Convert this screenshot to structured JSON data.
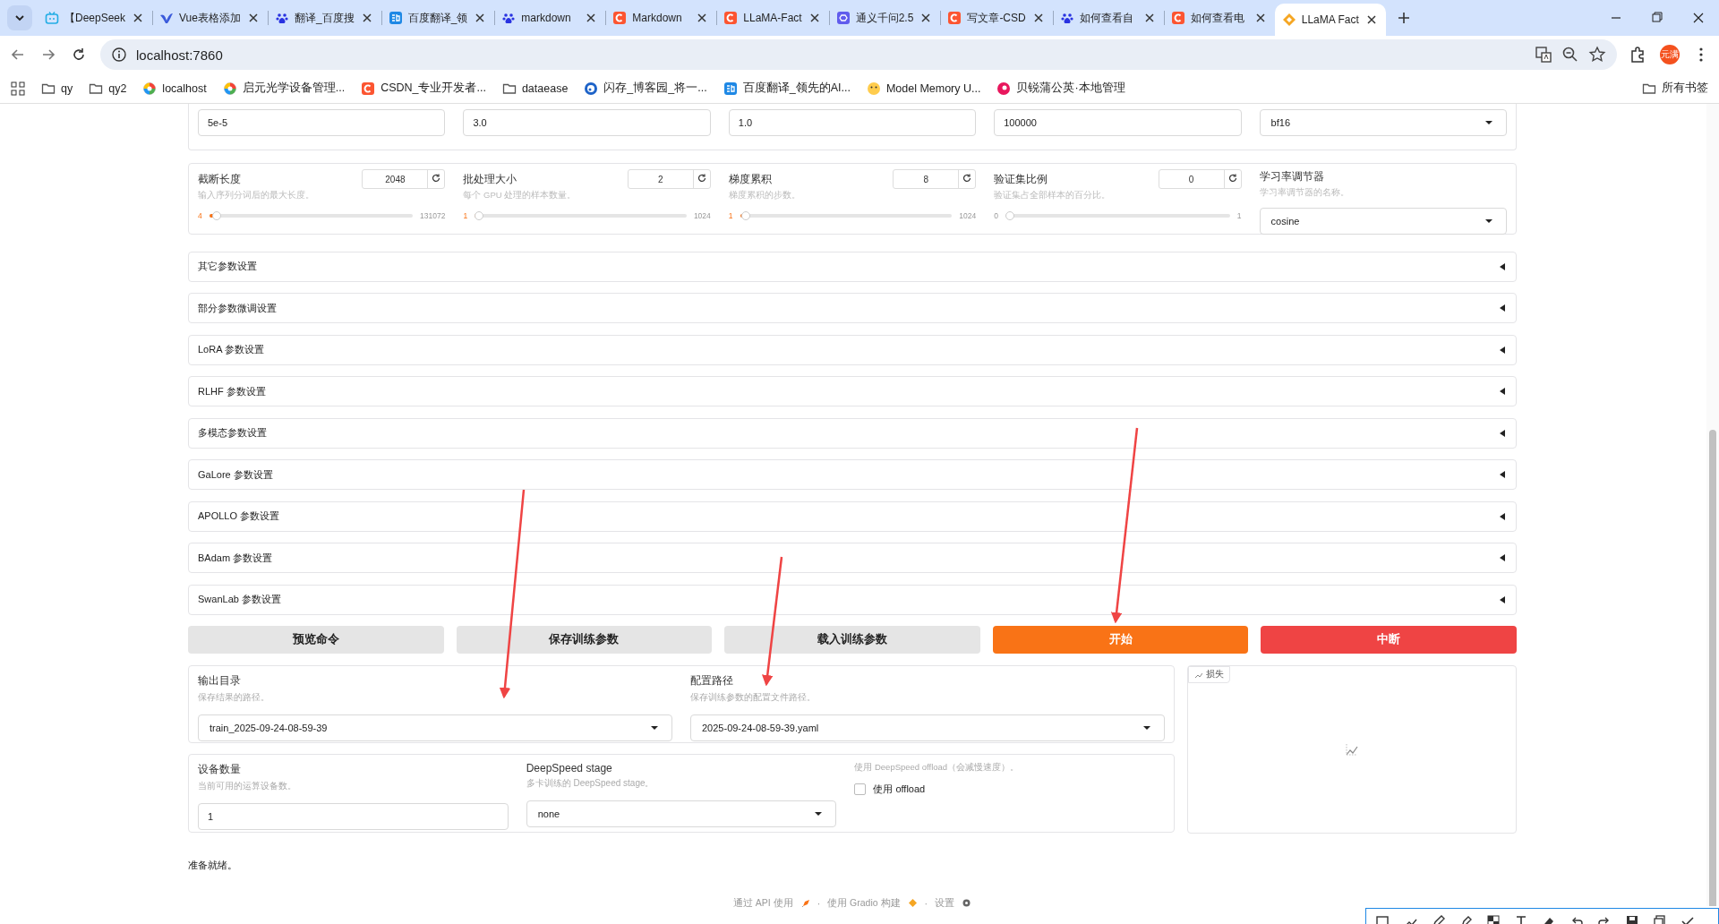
{
  "browser": {
    "tabs": [
      {
        "title": "【DeepSeek",
        "kind": "bilibili",
        "selected": false
      },
      {
        "title": "Vue表格添加",
        "kind": "vue",
        "selected": false
      },
      {
        "title": "翻译_百度搜",
        "kind": "baidu",
        "selected": false
      },
      {
        "title": "百度翻译_领",
        "kind": "fanyi",
        "selected": false
      },
      {
        "title": "markdown",
        "kind": "baidu",
        "selected": false
      },
      {
        "title": "Markdown",
        "kind": "csdn",
        "selected": false
      },
      {
        "title": "LLaMA-Fact",
        "kind": "csdn",
        "selected": false
      },
      {
        "title": "通义千问2.5",
        "kind": "tongyi",
        "selected": false
      },
      {
        "title": "写文章-CSD",
        "kind": "csdn",
        "selected": false
      },
      {
        "title": "如何查看自",
        "kind": "baidu",
        "selected": false
      },
      {
        "title": "如何查看电",
        "kind": "csdn",
        "selected": false
      },
      {
        "title": "LLaMA Fact",
        "kind": "llama",
        "selected": true
      }
    ],
    "url": "localhost:7860",
    "profile": "元满",
    "bookmarks": [
      {
        "label": "qy",
        "kind": "folder"
      },
      {
        "label": "qy2",
        "kind": "folder"
      },
      {
        "label": "localhost",
        "kind": "globe"
      },
      {
        "label": "启元光学设备管理...",
        "kind": "globe"
      },
      {
        "label": "CSDN_专业开发者...",
        "kind": "csdn"
      },
      {
        "label": "dataease",
        "kind": "folder"
      },
      {
        "label": "闪存_博客园_将一...",
        "kind": "cnblogs"
      },
      {
        "label": "百度翻译_领先的AI...",
        "kind": "fanyi"
      },
      {
        "label": "Model Memory U...",
        "kind": "hf"
      },
      {
        "label": "贝锐蒲公英·本地管理",
        "kind": "pgy"
      }
    ],
    "all_bookmarks": "所有书签"
  },
  "page": {
    "top_fields": [
      "5e-5",
      "3.0",
      "1.0",
      "100000"
    ],
    "top_dropdown": "bf16",
    "sliders": [
      {
        "label": "截断长度",
        "hint": "输入序列分词后的最大长度。",
        "value": "2048",
        "min": "4",
        "max": "131072",
        "level": 0.016
      },
      {
        "label": "批处理大小",
        "hint": "每个 GPU 处理的样本数量。",
        "value": "2",
        "min": "1",
        "max": "1024",
        "level": 0.001
      },
      {
        "label": "梯度累积",
        "hint": "梯度累积的步数。",
        "value": "8",
        "min": "1",
        "max": "1024",
        "level": 0.007
      },
      {
        "label": "验证集比例",
        "hint": "验证集占全部样本的百分比。",
        "value": "0",
        "min": "0",
        "max": "1",
        "level": 0
      }
    ],
    "scheduler": {
      "label": "学习率调节器",
      "hint": "学习率调节器的名称。",
      "value": "cosine"
    },
    "accordions": [
      {
        "label": "其它参数设置",
        "expanded": false
      },
      {
        "label": "部分参数微调设置",
        "expanded": false
      },
      {
        "label": "LoRA 参数设置",
        "expanded": false
      },
      {
        "label": "RLHF 参数设置",
        "expanded": false
      },
      {
        "label": "多模态参数设置",
        "expanded": false
      },
      {
        "label": "GaLore 参数设置",
        "expanded": false
      },
      {
        "label": "APOLLO 参数设置",
        "expanded": false
      },
      {
        "label": "BAdam 参数设置",
        "expanded": false
      },
      {
        "label": "SwanLab 参数设置",
        "expanded": false
      }
    ],
    "buttons": [
      {
        "label": "预览命令",
        "kind": "secondary"
      },
      {
        "label": "保存训练参数",
        "kind": "secondary"
      },
      {
        "label": "载入训练参数",
        "kind": "secondary"
      },
      {
        "label": "开始",
        "kind": "primary"
      },
      {
        "label": "中断",
        "kind": "stop"
      }
    ],
    "output_dir": {
      "label": "输出目录",
      "hint": "保存结果的路径。",
      "value": "train_2025-09-24-08-59-39"
    },
    "config_path": {
      "label": "配置路径",
      "hint": "保存训练参数的配置文件路径。",
      "value": "2025-09-24-08-59-39.yaml"
    },
    "device_count": {
      "label": "设备数量",
      "hint": "当前可用的运算设备数。",
      "value": "1"
    },
    "deepspeed": {
      "label": "DeepSpeed stage",
      "hint": "多卡训练的 DeepSpeed stage。",
      "value": "none"
    },
    "offload": {
      "hint": "使用 DeepSpeed offload（会减慢速度）。",
      "label": "使用 offload",
      "checked": false
    },
    "loss_plot": {
      "label": "损失"
    },
    "status": "准备就绪。",
    "footer": [
      "通过 API 使用",
      "使用 Gradio 构建",
      "设置"
    ],
    "footer_separator": "·"
  }
}
